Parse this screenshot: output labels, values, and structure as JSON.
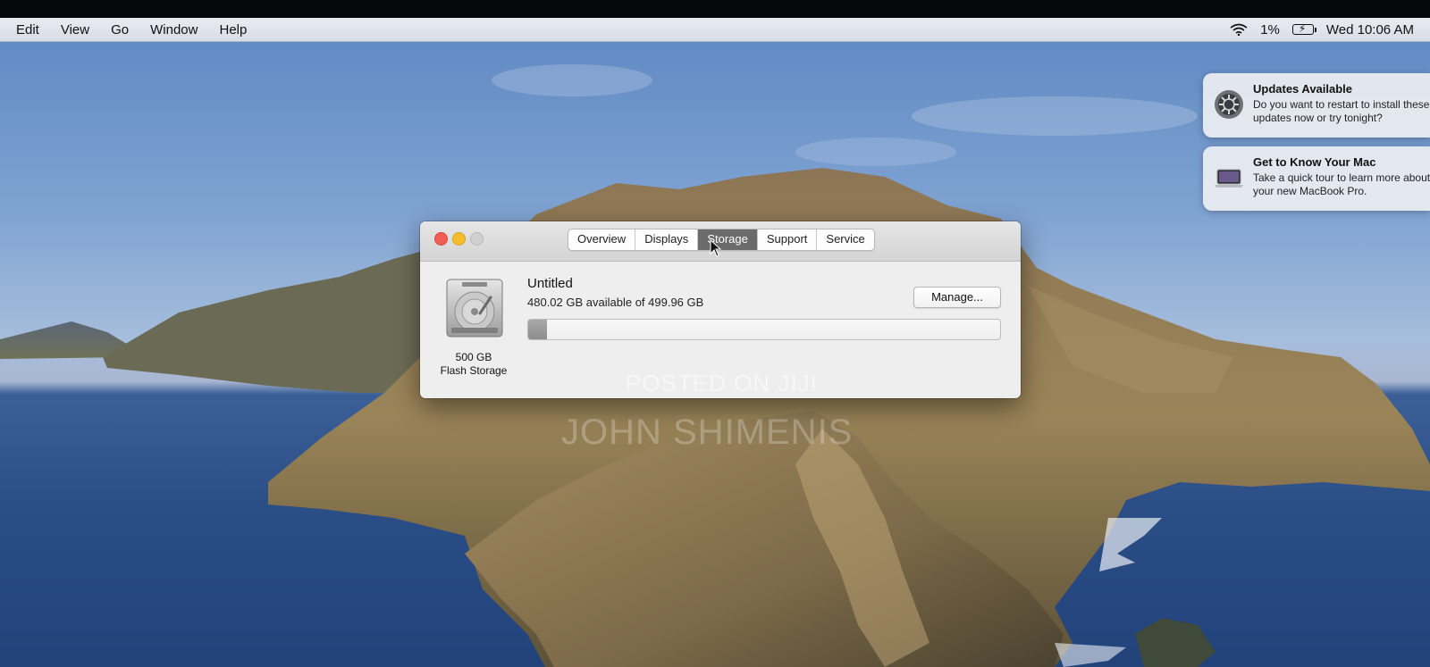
{
  "menubar": {
    "items": [
      "Edit",
      "View",
      "Go",
      "Window",
      "Help"
    ],
    "battery_percent": "1%",
    "clock": "Wed 10:06 AM"
  },
  "notifications": [
    {
      "title": "Updates Available",
      "body_line1": "Do you want to restart to install these",
      "body_line2": "updates now or try tonight?",
      "icon": "gear-icon"
    },
    {
      "title": "Get to Know Your Mac",
      "body_line1": "Take a quick tour to learn more about",
      "body_line2": "your new MacBook Pro.",
      "icon": "macbook-icon"
    }
  ],
  "window": {
    "tabs": [
      {
        "label": "Overview",
        "active": false
      },
      {
        "label": "Displays",
        "active": false
      },
      {
        "label": "Storage",
        "active": true
      },
      {
        "label": "Support",
        "active": false
      },
      {
        "label": "Service",
        "active": false
      }
    ],
    "disk": {
      "size": "500 GB",
      "kind": "Flash Storage"
    },
    "volume": {
      "name": "Untitled",
      "availability": "480.02 GB available of 499.96 GB",
      "used_fraction": 0.04
    },
    "manage_label": "Manage..."
  },
  "watermark": {
    "line1": "POSTED ON JIJI",
    "line2": "JOHN SHIMENIS"
  },
  "colors": {
    "close": "#f25d55",
    "minimize": "#f6be2f",
    "active_tab": "#6b6b6b"
  }
}
